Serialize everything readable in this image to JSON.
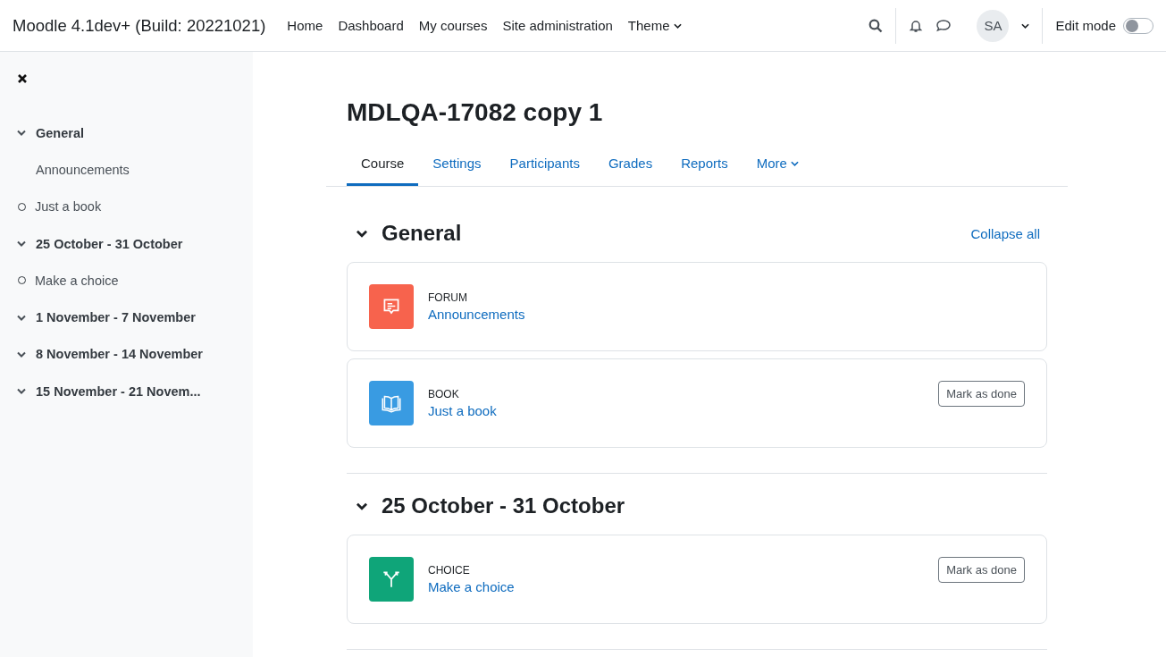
{
  "navbar": {
    "site_name": "Moodle 4.1dev+ (Build: 20221021)",
    "links": [
      {
        "label": "Home",
        "dropdown": false
      },
      {
        "label": "Dashboard",
        "dropdown": false
      },
      {
        "label": "My courses",
        "dropdown": false
      },
      {
        "label": "Site administration",
        "dropdown": false
      },
      {
        "label": "Theme",
        "dropdown": true
      }
    ],
    "user_initials": "SA",
    "edit_mode": {
      "label": "Edit mode",
      "on": false
    }
  },
  "course_index": [
    {
      "kind": "section",
      "label": "General",
      "expanded": true
    },
    {
      "kind": "activity",
      "label": "Announcements",
      "completion": false
    },
    {
      "kind": "activity",
      "label": "Just a book",
      "completion": true
    },
    {
      "kind": "section",
      "label": "25 October - 31 October",
      "expanded": true
    },
    {
      "kind": "activity",
      "label": "Make a choice",
      "completion": true
    },
    {
      "kind": "section",
      "label": "1 November - 7 November",
      "expanded": true
    },
    {
      "kind": "section",
      "label": "8 November - 14 November",
      "expanded": true
    },
    {
      "kind": "section",
      "label": "15 November - 21 Novem...",
      "expanded": true
    }
  ],
  "course": {
    "title": "MDLQA-17082 copy 1",
    "tabs": [
      {
        "label": "Course",
        "selected": true,
        "dropdown": false
      },
      {
        "label": "Settings",
        "selected": false,
        "dropdown": false
      },
      {
        "label": "Participants",
        "selected": false,
        "dropdown": false
      },
      {
        "label": "Grades",
        "selected": false,
        "dropdown": false
      },
      {
        "label": "Reports",
        "selected": false,
        "dropdown": false
      },
      {
        "label": "More",
        "selected": false,
        "dropdown": true
      }
    ],
    "collapse_all": "Collapse all",
    "sections": [
      {
        "title": "General",
        "expanded": true,
        "activities": [
          {
            "kind": "forum",
            "type_label": "FORUM",
            "name": "Announcements"
          },
          {
            "kind": "book",
            "type_label": "BOOK",
            "name": "Just a book",
            "mark_button": "Mark as done"
          }
        ]
      },
      {
        "title": "25 October - 31 October",
        "expanded": true,
        "activities": [
          {
            "kind": "choice",
            "type_label": "CHOICE",
            "name": "Make a choice",
            "mark_button": "Mark as done"
          }
        ]
      }
    ]
  }
}
